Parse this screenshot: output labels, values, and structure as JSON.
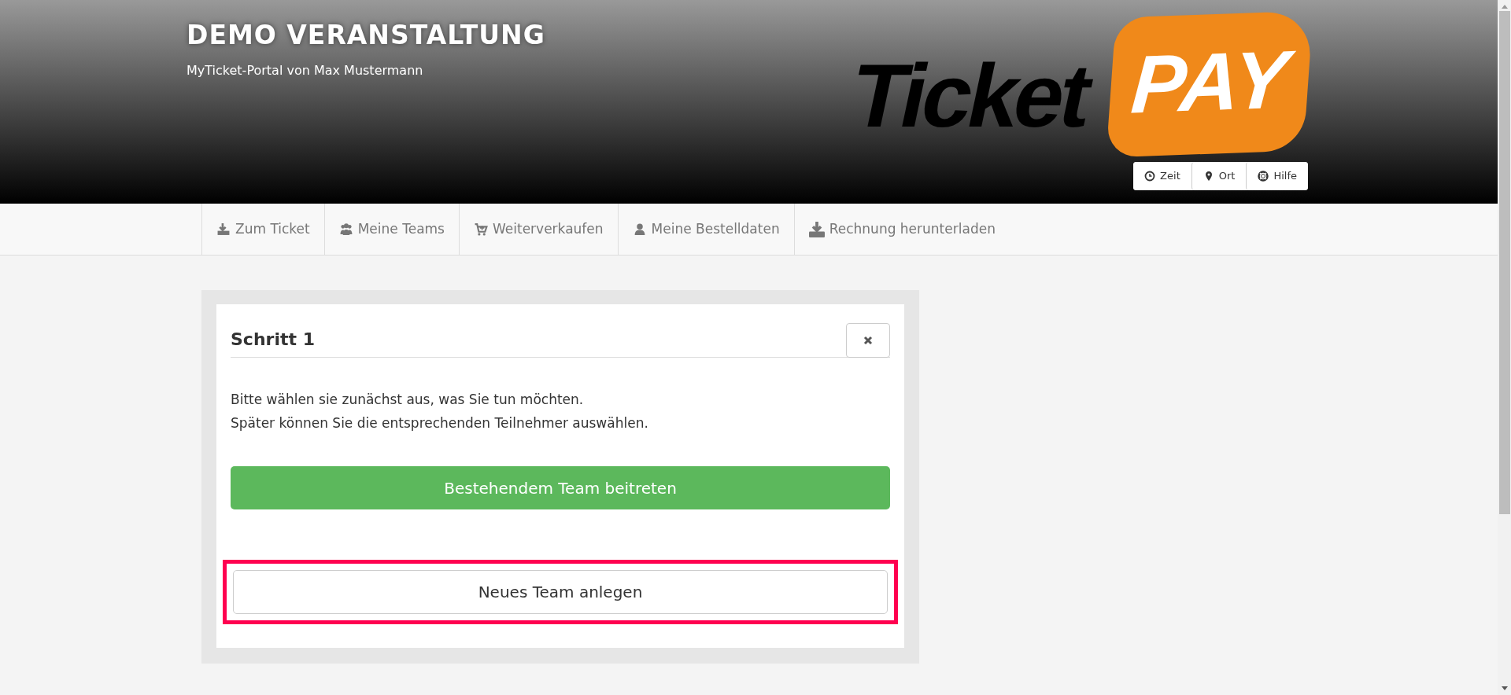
{
  "header": {
    "title": "DEMO VERANSTALTUNG",
    "subtitle": "MyTicket-Portal von Max Mustermann",
    "logo": {
      "text_1": "Ticket",
      "text_2": "PAY"
    },
    "info_buttons": [
      {
        "label": "Zeit"
      },
      {
        "label": "Ort"
      },
      {
        "label": "Hilfe"
      }
    ]
  },
  "nav": {
    "items": [
      {
        "label": "Zum Ticket"
      },
      {
        "label": "Meine Teams"
      },
      {
        "label": "Weiterverkaufen"
      },
      {
        "label": "Meine Bestelldaten"
      },
      {
        "label": "Rechnung herunterladen"
      }
    ]
  },
  "dialog": {
    "title": "Schritt 1",
    "lines": [
      "Bitte wählen sie zunächst aus, was Sie tun möchten.",
      "Später können Sie die entsprechenden Teilnehmer auswählen."
    ],
    "buttons": [
      {
        "label": "Bestehendem Team beitreten",
        "kind": "primary",
        "highlighted": false
      },
      {
        "label": "Neues Team anlegen",
        "kind": "default",
        "highlighted": true
      }
    ]
  }
}
